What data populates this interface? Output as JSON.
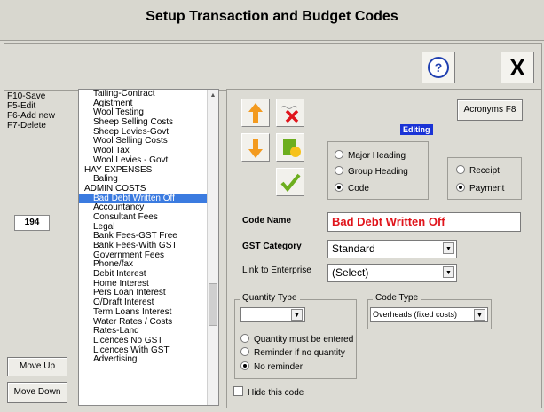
{
  "window": {
    "title": "Setup Transaction and Budget  Codes"
  },
  "shortcuts": [
    "F10-Save",
    "F5-Edit",
    "F6-Add new",
    "F7-Delete"
  ],
  "record_count": "194",
  "toolbar": {
    "help_icon": "question-circle-icon",
    "close_label": "X"
  },
  "left_buttons": {
    "move_up": "Move Up",
    "move_down": "Move Down"
  },
  "codes_list": [
    {
      "label": "Tailing-Contract",
      "type": "item"
    },
    {
      "label": "Agistment",
      "type": "item"
    },
    {
      "label": "Wool Testing",
      "type": "item"
    },
    {
      "label": "Sheep Selling Costs",
      "type": "item"
    },
    {
      "label": "Sheep Levies-Govt",
      "type": "item"
    },
    {
      "label": "Wool Selling Costs",
      "type": "item"
    },
    {
      "label": "Wool Tax",
      "type": "item"
    },
    {
      "label": "Wool Levies - Govt",
      "type": "item"
    },
    {
      "label": "HAY EXPENSES",
      "type": "header"
    },
    {
      "label": "Baling",
      "type": "item"
    },
    {
      "label": "ADMIN COSTS",
      "type": "header"
    },
    {
      "label": "Bad Debt Written Off",
      "type": "item",
      "selected": true
    },
    {
      "label": "Accountancy",
      "type": "item"
    },
    {
      "label": "Consultant Fees",
      "type": "item"
    },
    {
      "label": "Legal",
      "type": "item"
    },
    {
      "label": "Bank Fees-GST Free",
      "type": "item"
    },
    {
      "label": "Bank Fees-With GST",
      "type": "item"
    },
    {
      "label": "Government Fees",
      "type": "item"
    },
    {
      "label": "Phone/fax",
      "type": "item"
    },
    {
      "label": "Debit Interest",
      "type": "item"
    },
    {
      "label": "Home Interest",
      "type": "item"
    },
    {
      "label": "Pers Loan Interest",
      "type": "item"
    },
    {
      "label": "O/Draft Interest",
      "type": "item"
    },
    {
      "label": "Term Loans Interest",
      "type": "item"
    },
    {
      "label": "Water Rates / Costs",
      "type": "item"
    },
    {
      "label": "Rates-Land",
      "type": "item"
    },
    {
      "label": "Licences No GST",
      "type": "item"
    },
    {
      "label": "Licences With GST",
      "type": "item"
    },
    {
      "label": "Advertising",
      "type": "item"
    }
  ],
  "panel": {
    "acronyms_button": "Acronyms F8",
    "editing_badge": "Editing",
    "heading_options": [
      "Major Heading",
      "Group Heading",
      "Code"
    ],
    "heading_selected": "Code",
    "direction_options": [
      "Receipt",
      "Payment"
    ],
    "direction_selected": "Payment",
    "code_name_label": "Code Name",
    "code_name_value": "Bad Debt Written Off",
    "gst_label": "GST Category",
    "gst_value": "Standard",
    "enterprise_label": "Link to Enterprise",
    "enterprise_value": "(Select)",
    "quantity_type_legend": "Quantity Type",
    "quantity_type_value": "",
    "quantity_options": [
      "Quantity must be entered",
      "Reminder if no quantity",
      "No reminder"
    ],
    "quantity_selected": "No reminder",
    "code_type_legend": "Code Type",
    "code_type_value": "Overheads (fixed costs)",
    "hide_code_label": "Hide this code"
  },
  "colors": {
    "selection": "#3b7be0",
    "code_name_text": "#e0141b",
    "editing_badge_bg": "#1a33d6",
    "arrow_orange": "#f39a1e",
    "delete_red": "#e0141b",
    "check_green": "#6cae1e"
  }
}
